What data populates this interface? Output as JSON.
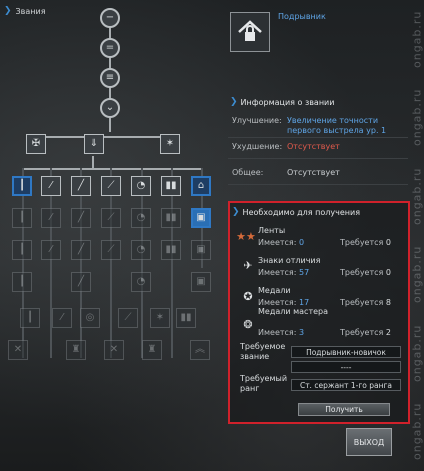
{
  "window": {
    "title": "Звания"
  },
  "rank": {
    "name": "Подрывник",
    "icon": "house-lock-icon"
  },
  "info": {
    "section_title": "Информация о звании",
    "improvement_label": "Улучшение:",
    "improvement_value": "Увеличение точности первого выстрела ур. 1",
    "deterioration_label": "Ухудшение:",
    "deterioration_value": "Отсутствует",
    "general_label": "Общее:",
    "general_value": "Отсутствует"
  },
  "requirements": {
    "section_title": "Необходимо для получения",
    "items": [
      {
        "name": "Ленты",
        "icon": "ribbons-icon",
        "have_label": "Имеется:",
        "have": "0",
        "need_label": "Требуется",
        "need": "0"
      },
      {
        "name": "Знаки отличия",
        "icon": "badge-icon",
        "have_label": "Имеется:",
        "have": "57",
        "need_label": "Требуется",
        "need": "0"
      },
      {
        "name": "Медали",
        "icon": "medal-icon",
        "have_label": "Имеется:",
        "have": "17",
        "need_label": "Требуется",
        "need": "8"
      },
      {
        "name": "Медали мастера",
        "icon": "master-medal-icon",
        "have_label": "Имеется:",
        "have": "3",
        "need_label": "Требуется",
        "need": "2"
      }
    ],
    "required_title_label": "Требуемое звание",
    "required_title_values": [
      "Подрывник-новичок",
      "----"
    ],
    "required_rank_label": "Требуемый ранг",
    "required_rank_value": "Ст. сержант 1-го ранга",
    "get_button": "Получить"
  },
  "exit_button": "ВЫХОД",
  "watermark": [
    "ongab.ru",
    "ongab.ru",
    "ongab.ru",
    "ongab.ru",
    "ongab.ru",
    "ongab.ru"
  ],
  "colors": {
    "accent": "#3c8cd0",
    "highlight": "#d0212b",
    "value_blue": "#5fa5e6",
    "value_red": "#e25a4c"
  }
}
